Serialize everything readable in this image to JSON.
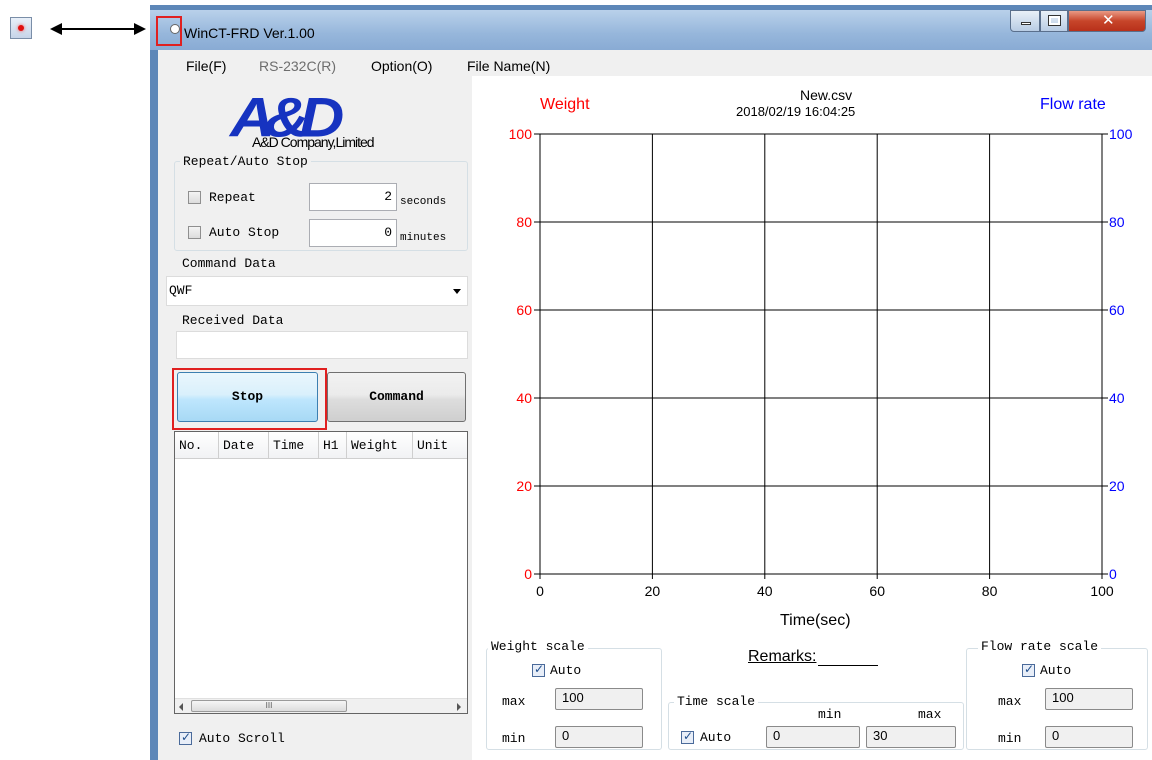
{
  "window": {
    "title": "WinCT-FRD Ver.1.00"
  },
  "menu": [
    {
      "label": "File(F)",
      "disabled": false
    },
    {
      "label": "RS-232C(R)",
      "disabled": true
    },
    {
      "label": "Option(O)",
      "disabled": false
    },
    {
      "label": "File Name(N)",
      "disabled": false
    }
  ],
  "logo": {
    "text": "A&D",
    "company": "A&D Company,Limited"
  },
  "repeat_group": {
    "title": "Repeat/Auto Stop",
    "repeat_label": "Repeat",
    "repeat_value": "2",
    "repeat_unit": "seconds",
    "repeat_checked": false,
    "autostop_label": "Auto Stop",
    "autostop_value": "0",
    "autostop_unit": "minutes",
    "autostop_checked": false
  },
  "command": {
    "label": "Command Data",
    "selected": "QWF"
  },
  "received": {
    "label": "Received Data",
    "value": ""
  },
  "buttons": {
    "stop": "Stop",
    "command": "Command"
  },
  "table": {
    "columns": [
      "No.",
      "Date",
      "Time",
      "H1",
      "Weight",
      "Unit"
    ],
    "scroll_grip": "III"
  },
  "auto_scroll": {
    "label": "Auto Scroll",
    "checked": true
  },
  "chart_header": {
    "file": "New.csv",
    "datetime": "2018/02/19 16:04:25"
  },
  "weight_scale": {
    "title": "Weight scale",
    "auto_label": "Auto",
    "max_label": "max",
    "max": "100",
    "min_label": "min",
    "min": "0"
  },
  "time_scale": {
    "title": "Time scale",
    "auto_label": "Auto",
    "min_label": "min",
    "max_label": "max",
    "min": "0",
    "max": "30"
  },
  "flow_scale": {
    "title": "Flow rate scale",
    "auto_label": "Auto",
    "max_label": "max",
    "max": "100",
    "min_label": "min",
    "min": "0"
  },
  "remarks": "Remarks:",
  "colors": {
    "weight": "#ff0000",
    "flow": "#0000ff",
    "highlight": "#e02020",
    "logo": "#1633c0"
  },
  "chart_data": {
    "type": "line",
    "xlabel": "Time(sec)",
    "xlim": [
      0,
      100
    ],
    "xticks": [
      0,
      20,
      40,
      60,
      80,
      100
    ],
    "ylim_left": [
      0,
      100
    ],
    "yticks_left": [
      0,
      20,
      40,
      60,
      80,
      100
    ],
    "ylim_right": [
      0,
      100
    ],
    "yticks_right": [
      0,
      20,
      40,
      60,
      80,
      100
    ],
    "grid": true,
    "series": [
      {
        "name": "Weight",
        "axis": "left",
        "color": "#ff0000",
        "x": [],
        "y": []
      },
      {
        "name": "Flow rate",
        "axis": "right",
        "color": "#0000ff",
        "x": [],
        "y": []
      }
    ]
  }
}
